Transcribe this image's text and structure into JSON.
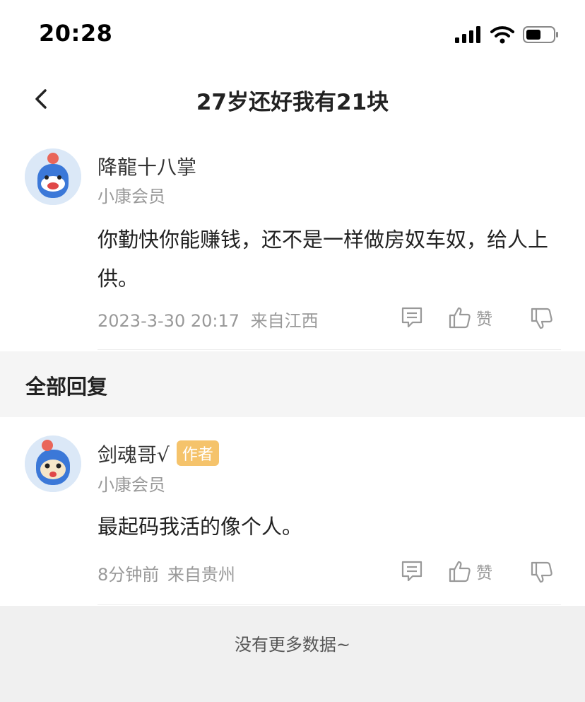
{
  "status_bar": {
    "time": "20:28"
  },
  "nav": {
    "title": "27岁还好我有21块"
  },
  "post": {
    "username": "降龍十八掌",
    "member_level": "小康会员",
    "content": "你勤快你能赚钱，还不是一样做房奴车奴，给人上供。",
    "timestamp": "2023-3-30 20:17",
    "location": "来自江西",
    "like_label": "赞"
  },
  "replies_section": {
    "title": "全部回复"
  },
  "replies": [
    {
      "username": "剑魂哥√",
      "badge": "作者",
      "member_level": "小康会员",
      "content": "最起码我活的像个人。",
      "timestamp": "8分钟前",
      "location": "来自贵州",
      "like_label": "赞"
    }
  ],
  "footer": {
    "text": "没有更多数据~"
  },
  "colors": {
    "badge": "#f5c36b",
    "section_bg": "#f5f5f5",
    "footer_bg": "#f0f0f0",
    "muted": "#999999"
  }
}
